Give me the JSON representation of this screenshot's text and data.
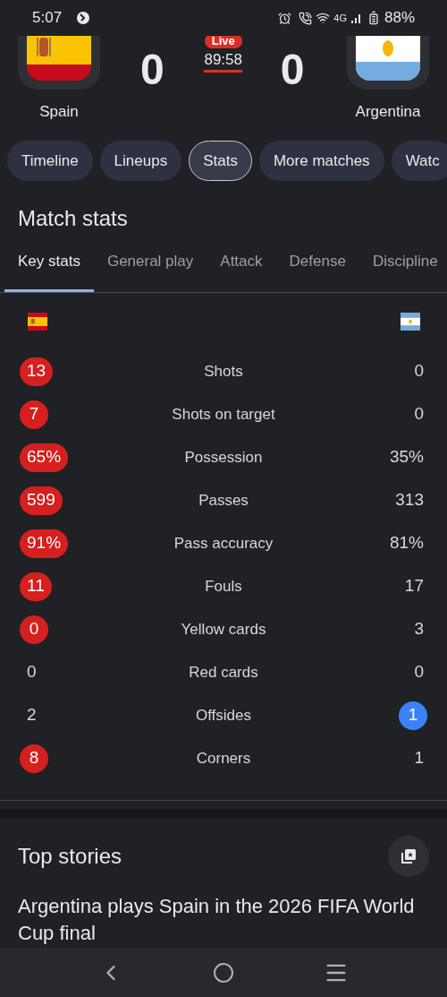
{
  "status_bar": {
    "time": "5:07",
    "network": "4G",
    "battery": "88%"
  },
  "match": {
    "home": {
      "name": "Spain",
      "score": "0"
    },
    "away": {
      "name": "Argentina",
      "score": "0"
    },
    "badge": "Live",
    "clock": "89:58"
  },
  "chips": [
    {
      "label": "Timeline",
      "selected": false
    },
    {
      "label": "Lineups",
      "selected": false
    },
    {
      "label": "Stats",
      "selected": true
    },
    {
      "label": "More matches",
      "selected": false
    },
    {
      "label": "Watc",
      "selected": false
    }
  ],
  "section_title": "Match stats",
  "stat_tabs": [
    {
      "label": "Key stats",
      "selected": true
    },
    {
      "label": "General play",
      "selected": false
    },
    {
      "label": "Attack",
      "selected": false
    },
    {
      "label": "Defense",
      "selected": false
    },
    {
      "label": "Discipline",
      "selected": false
    }
  ],
  "teams": [
    {
      "color": "#d61f1f"
    },
    {
      "color": "#3b82f6"
    }
  ],
  "stats": [
    {
      "label": "Shots",
      "home": {
        "value": "13",
        "highlighted": true
      },
      "away": {
        "value": "0",
        "highlighted": false
      }
    },
    {
      "label": "Shots on target",
      "home": {
        "value": "7",
        "highlighted": true
      },
      "away": {
        "value": "0",
        "highlighted": false
      }
    },
    {
      "label": "Possession",
      "home": {
        "value": "65%",
        "highlighted": true
      },
      "away": {
        "value": "35%",
        "highlighted": false
      }
    },
    {
      "label": "Passes",
      "home": {
        "value": "599",
        "highlighted": true
      },
      "away": {
        "value": "313",
        "highlighted": false
      }
    },
    {
      "label": "Pass accuracy",
      "home": {
        "value": "91%",
        "highlighted": true
      },
      "away": {
        "value": "81%",
        "highlighted": false
      }
    },
    {
      "label": "Fouls",
      "home": {
        "value": "11",
        "highlighted": true
      },
      "away": {
        "value": "17",
        "highlighted": false
      }
    },
    {
      "label": "Yellow cards",
      "home": {
        "value": "0",
        "highlighted": true
      },
      "away": {
        "value": "3",
        "highlighted": false
      }
    },
    {
      "label": "Red cards",
      "home": {
        "value": "0",
        "highlighted": false
      },
      "away": {
        "value": "0",
        "highlighted": false
      }
    },
    {
      "label": "Offsides",
      "home": {
        "value": "2",
        "highlighted": false
      },
      "away": {
        "value": "1",
        "highlighted": true
      }
    },
    {
      "label": "Corners",
      "home": {
        "value": "8",
        "highlighted": true
      },
      "away": {
        "value": "1",
        "highlighted": false
      }
    }
  ],
  "top_stories": {
    "title": "Top stories",
    "headline": "Argentina plays Spain in the 2026 FIFA World Cup final"
  }
}
